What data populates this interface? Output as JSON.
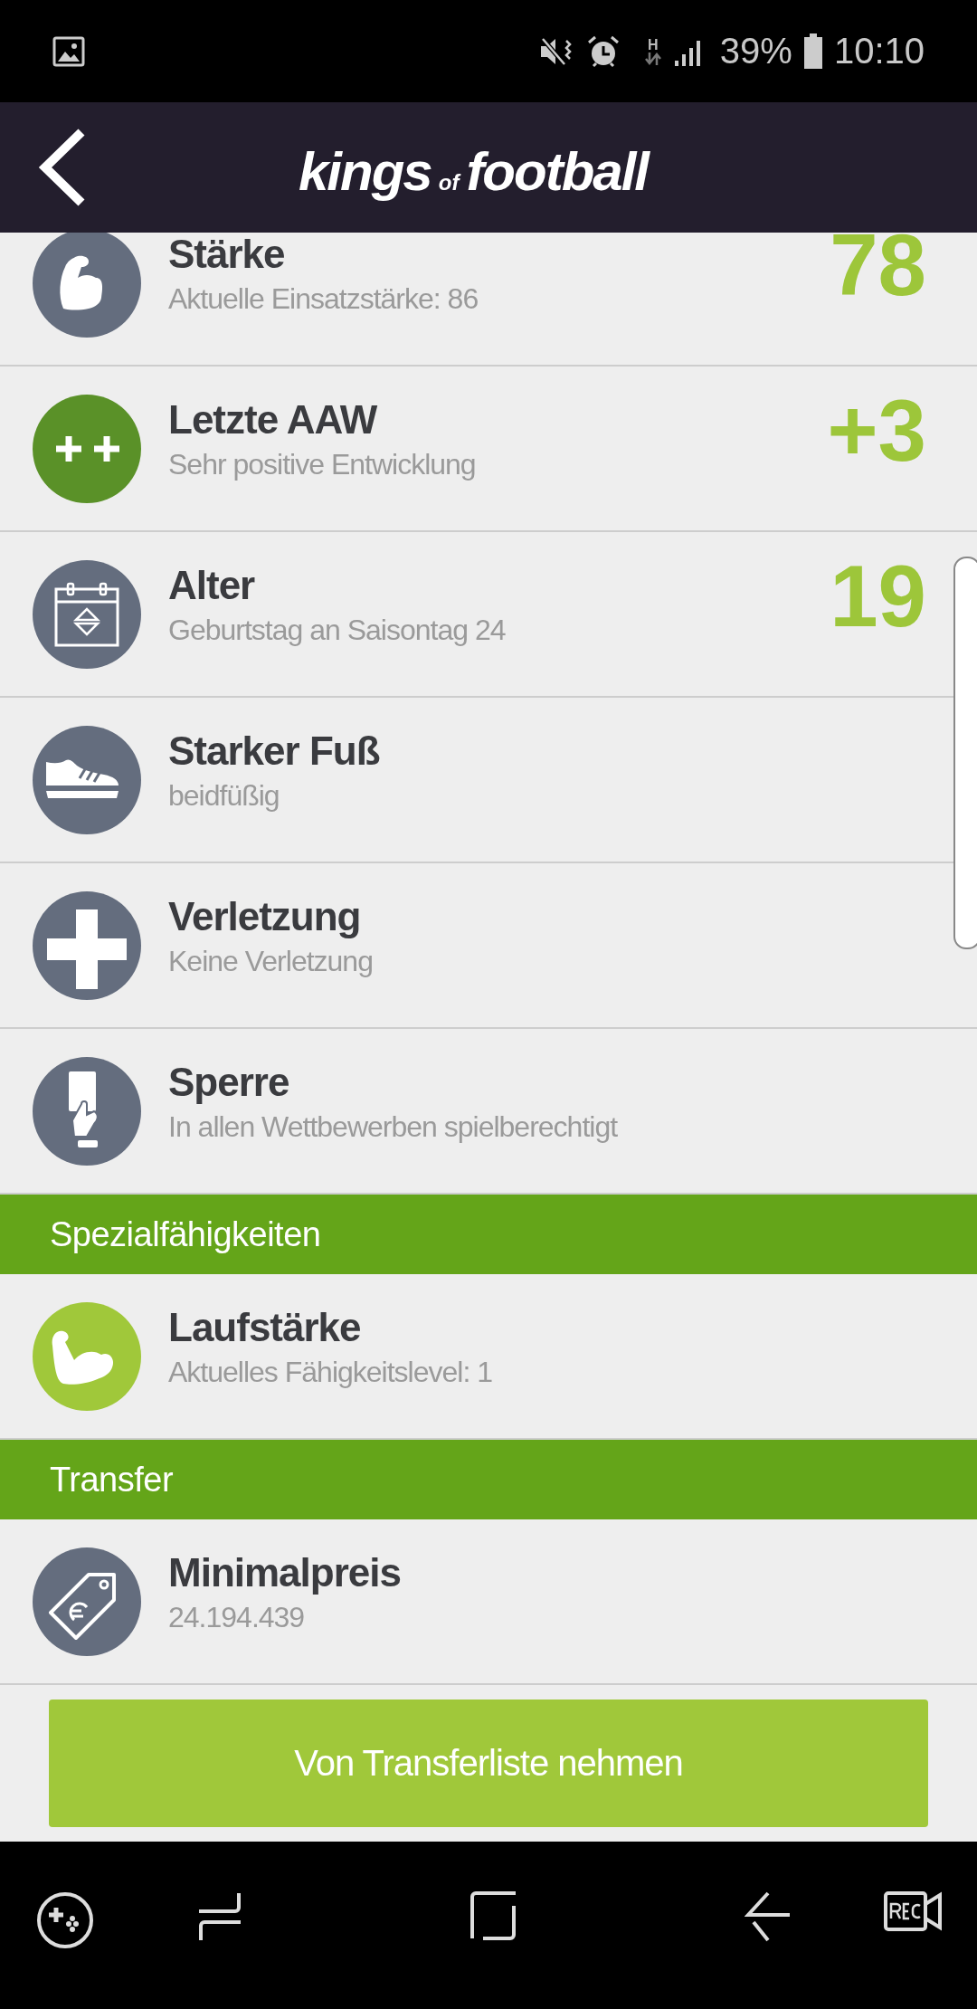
{
  "status_bar": {
    "network": "H",
    "battery": "39%",
    "time": "10:10"
  },
  "header": {
    "logo": {
      "first": "kings",
      "middle": "of",
      "last": "football"
    }
  },
  "items": [
    {
      "kind": "row",
      "color": "#646d7e",
      "title": "Stärke",
      "subtitle": "Aktuelle Einsatzstärke: 86",
      "value": "78"
    },
    {
      "kind": "row",
      "color": "#5a9128",
      "title": "Letzte AAW",
      "subtitle": "Sehr positive Entwicklung",
      "value": "+3"
    },
    {
      "kind": "row",
      "color": "#646d7e",
      "title": "Alter",
      "subtitle": "Geburtstag an Saisontag 24",
      "value": "19"
    },
    {
      "kind": "row",
      "color": "#646d7e",
      "title": "Starker Fuß",
      "subtitle": "beidfüßig"
    },
    {
      "kind": "row",
      "color": "#646d7e",
      "title": "Verletzung",
      "subtitle": "Keine Verletzung"
    },
    {
      "kind": "row",
      "color": "#646d7e",
      "title": "Sperre",
      "subtitle": "In allen Wettbewerben spielberechtigt"
    },
    {
      "kind": "section",
      "title": "Spezialfähigkeiten"
    },
    {
      "kind": "row",
      "color": "#a0c83a",
      "title": "Laufstärke",
      "subtitle": "Aktuelles Fähigkeitslevel: 1"
    },
    {
      "kind": "section",
      "title": "Transfer"
    },
    {
      "kind": "row",
      "color": "#646d7e",
      "title": "Minimalpreis",
      "subtitle": "24.194.439"
    }
  ],
  "button": {
    "label": "Von Transferliste nehmen"
  }
}
